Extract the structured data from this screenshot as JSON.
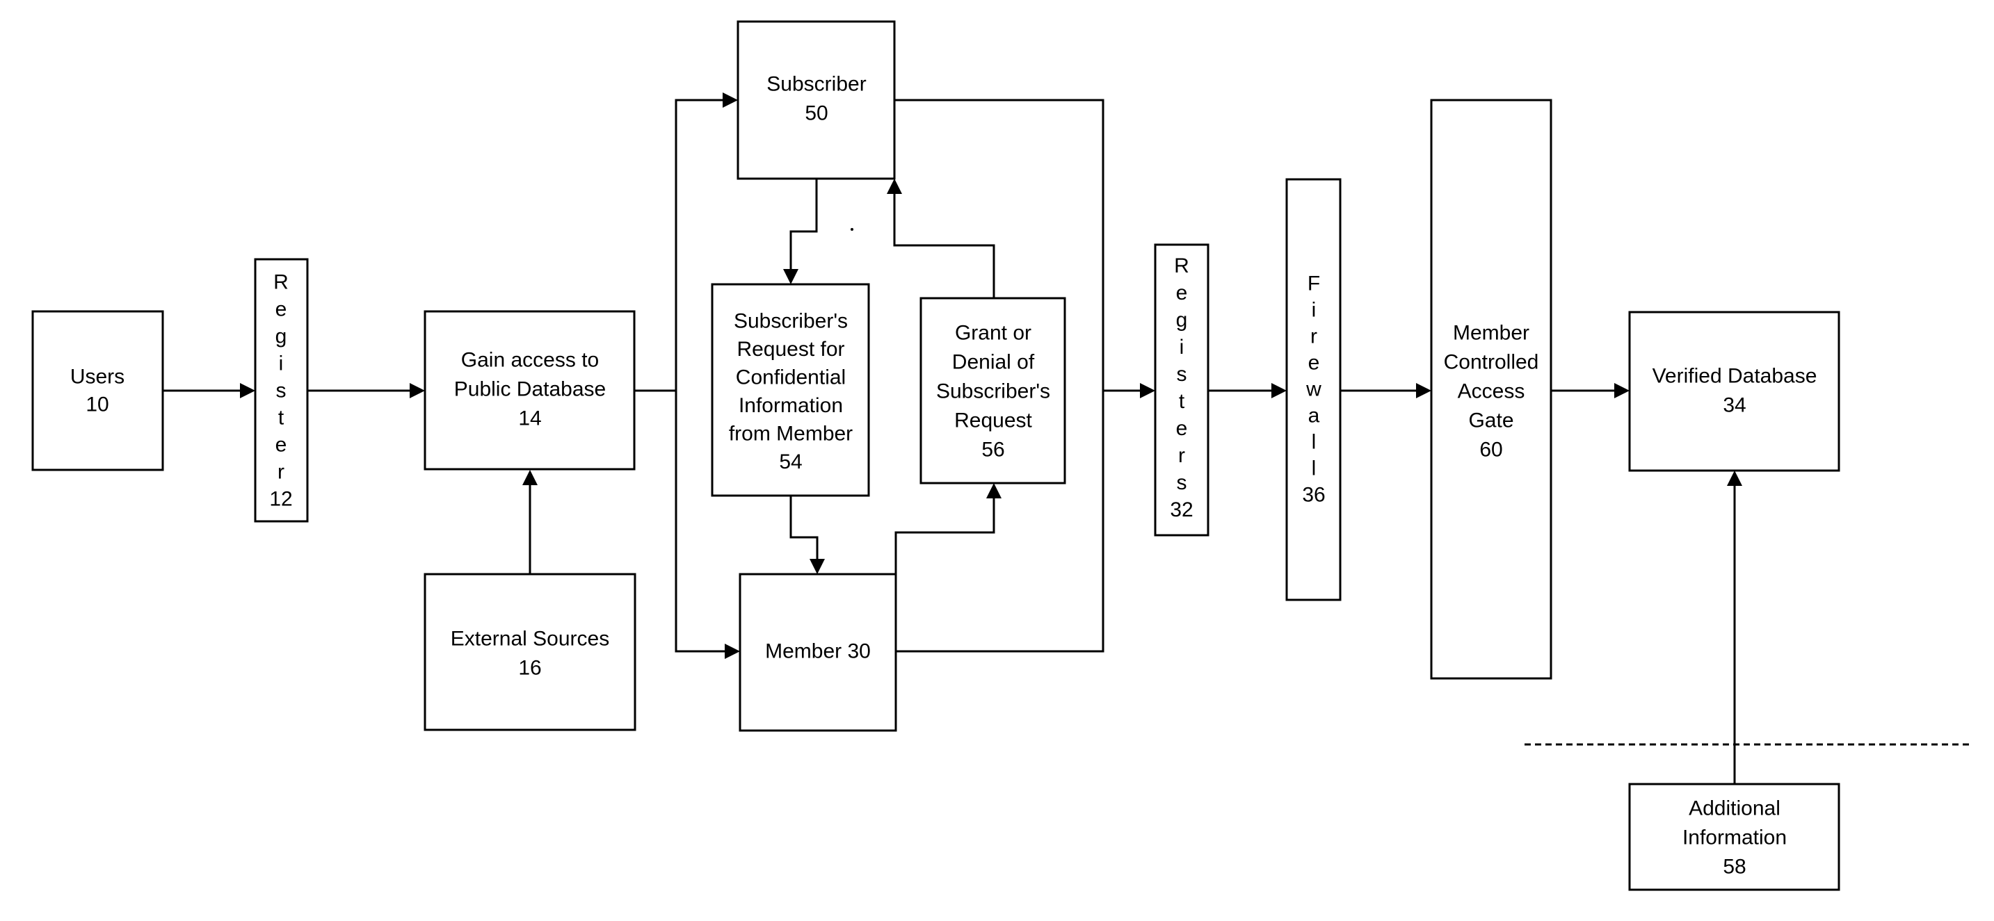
{
  "diagram": {
    "type": "flowchart",
    "colors": {
      "stroke": "#000000",
      "background": "#ffffff"
    },
    "nodes": {
      "users": {
        "lines": [
          "Users",
          "10"
        ]
      },
      "register_12": {
        "lines": [
          "R",
          "e",
          "g",
          "i",
          "s",
          "t",
          "e",
          "r",
          "12"
        ]
      },
      "public_db": {
        "lines": [
          "Gain access to",
          "Public Database",
          "14"
        ]
      },
      "external_sources": {
        "lines": [
          "External Sources",
          "16"
        ]
      },
      "subscriber": {
        "lines": [
          "Subscriber",
          "50"
        ]
      },
      "request": {
        "lines": [
          "Subscriber's",
          "Request for",
          "Confidential",
          "Information",
          "from Member",
          "54"
        ]
      },
      "grant_denial": {
        "lines": [
          "Grant or",
          "Denial of",
          "Subscriber's",
          "Request",
          "56"
        ]
      },
      "member": {
        "lines": [
          "Member 30"
        ]
      },
      "registers_32": {
        "lines": [
          "R",
          "e",
          "g",
          "i",
          "s",
          "t",
          "e",
          "r",
          "s",
          "32"
        ]
      },
      "firewall": {
        "lines": [
          "F",
          "i",
          "r",
          "e",
          "w",
          "a",
          "l",
          "l",
          "36"
        ]
      },
      "access_gate": {
        "lines": [
          "Member",
          "Controlled",
          "Access",
          "Gate",
          "60"
        ]
      },
      "verified_db": {
        "lines": [
          "Verified Database",
          "34"
        ]
      },
      "additional_info": {
        "lines": [
          "Additional",
          "Information",
          "58"
        ]
      }
    },
    "edges": [
      {
        "from": "users",
        "to": "register_12"
      },
      {
        "from": "register_12",
        "to": "public_db"
      },
      {
        "from": "external_sources",
        "to": "public_db"
      },
      {
        "from": "public_db",
        "to": "subscriber"
      },
      {
        "from": "public_db",
        "to": "member"
      },
      {
        "from": "subscriber",
        "to": "request"
      },
      {
        "from": "request",
        "to": "member"
      },
      {
        "from": "member",
        "to": "grant_denial"
      },
      {
        "from": "grant_denial",
        "to": "subscriber"
      },
      {
        "from": "subscriber",
        "to": "registers_32"
      },
      {
        "from": "member",
        "to": "registers_32"
      },
      {
        "from": "registers_32",
        "to": "firewall"
      },
      {
        "from": "firewall",
        "to": "access_gate"
      },
      {
        "from": "access_gate",
        "to": "verified_db"
      },
      {
        "from": "additional_info",
        "to": "verified_db"
      }
    ]
  }
}
